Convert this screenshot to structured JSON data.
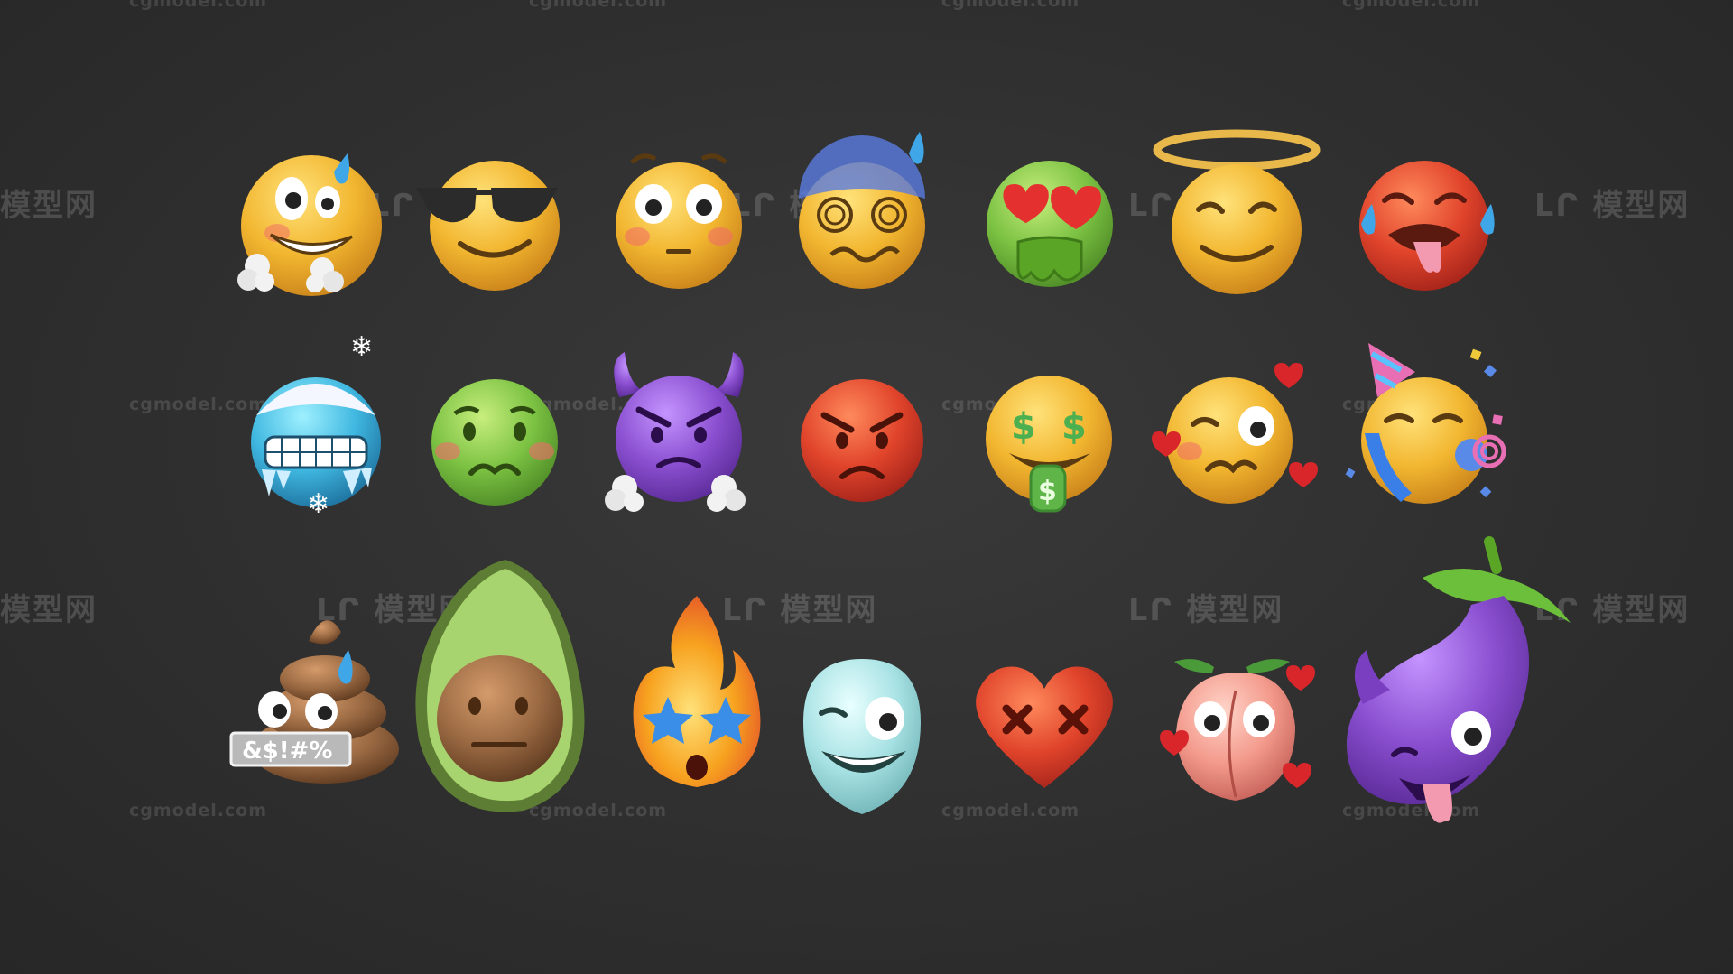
{
  "watermarks": {
    "text": "cgmodel.com",
    "logo": "模型网"
  },
  "emojis": {
    "row1": [
      "hot-sweat-face",
      "sunglasses-face",
      "flushed-face",
      "dizzy-sweat-face",
      "sick-heart-eyes-face",
      "halo-face",
      "crying-tongue-face"
    ],
    "row2": [
      "frozen-face",
      "nauseated-face",
      "devil-face",
      "angry-face",
      "money-face",
      "wink-hearts-face",
      "party-face"
    ],
    "row3": [
      "poop-swearing",
      "avocado-face",
      "fire-face",
      "alien-wink-face",
      "dead-heart",
      "peach-face",
      "eggplant-devil-face"
    ]
  },
  "poop_sign": "&$!#%",
  "colors": {
    "background": "#2f2f2f",
    "yellow": "#f2b630",
    "red": "#e0442b",
    "green": "#7cc243",
    "purple": "#8a4fd0"
  }
}
